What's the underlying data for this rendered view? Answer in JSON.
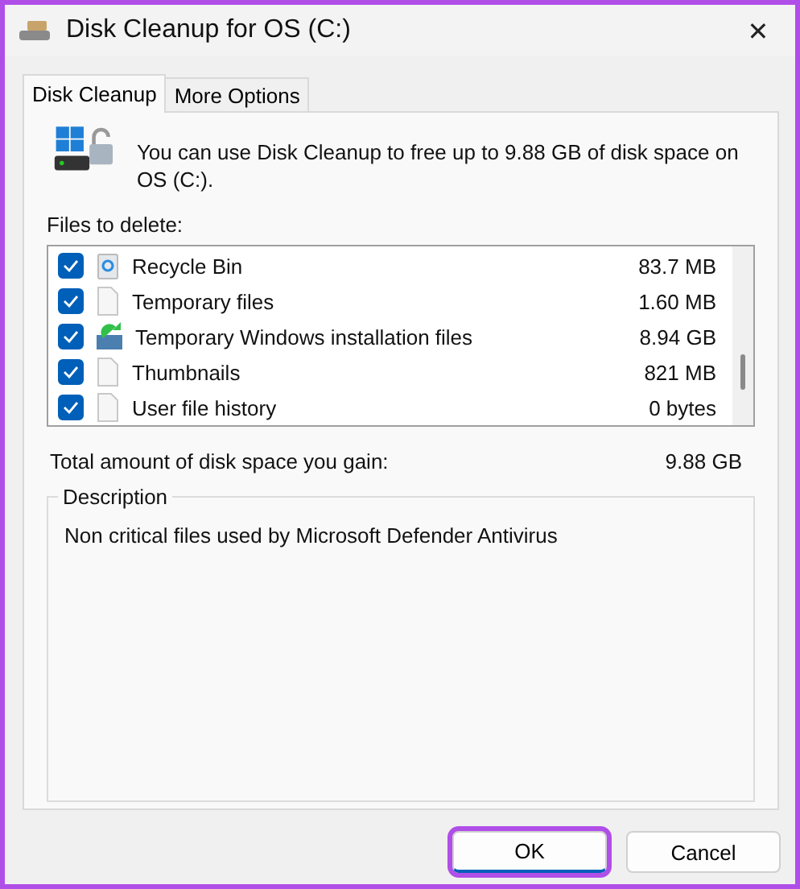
{
  "window": {
    "title": "Disk Cleanup for OS (C:)",
    "close": "✕"
  },
  "tabs": [
    {
      "label": "Disk Cleanup",
      "selected": true
    },
    {
      "label": "More Options",
      "selected": false
    }
  ],
  "intro": "You can use Disk Cleanup to free up to 9.88 GB of disk space on OS (C:).",
  "files_label": "Files to delete:",
  "files": [
    {
      "kind": "recycle",
      "name": "Recycle Bin",
      "size": "83.7 MB",
      "checked": true
    },
    {
      "kind": "file",
      "name": "Temporary files",
      "size": "1.60 MB",
      "checked": true
    },
    {
      "kind": "install",
      "name": "Temporary Windows installation files",
      "size": "8.94 GB",
      "checked": true
    },
    {
      "kind": "file",
      "name": "Thumbnails",
      "size": "821 MB",
      "checked": true
    },
    {
      "kind": "file",
      "name": "User file history",
      "size": "0 bytes",
      "checked": true
    }
  ],
  "total": {
    "label": "Total amount of disk space you gain:",
    "value": "9.88 GB"
  },
  "description": {
    "title": "Description",
    "text": "Non critical files used by Microsoft Defender Antivirus"
  },
  "buttons": [
    {
      "label": "OK",
      "highlighted": true
    },
    {
      "label": "Cancel",
      "highlighted": false
    }
  ]
}
